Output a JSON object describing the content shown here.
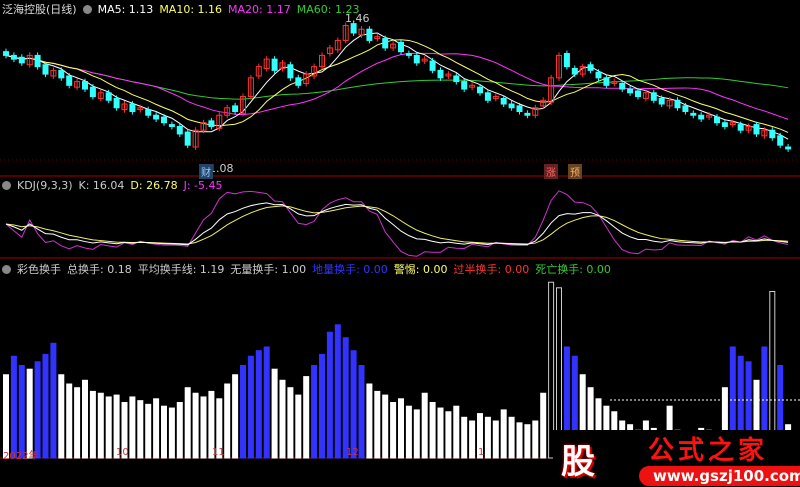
{
  "header": {
    "title": "泛海控股(日线)",
    "ma5": "MA5: 1.13",
    "ma10": "MA10: 1.16",
    "ma20": "MA20: 1.17",
    "ma60": "MA60: 1.23",
    "high_label": "1.46",
    "low_label": "1.08",
    "tag_cai": "财",
    "tag_zhang": "涨",
    "tag_yu": "预"
  },
  "kdj": {
    "name": "KDJ(9,3,3)",
    "k": "K: 16.04",
    "d": "D: 26.78",
    "j": "J: -5.45"
  },
  "turnover": {
    "name": "彩色换手",
    "total": "总换手: 0.18",
    "avg": "平均换手线: 1.19",
    "none": "无量换手: 1.00",
    "low": "地量换手: 0.00",
    "warn": "警惕: 0.00",
    "half": "过半换手: 0.00",
    "dead": "死亡换手: 0.00"
  },
  "axis": {
    "labels": [
      "2022年",
      "10",
      "11",
      "12",
      "1"
    ]
  },
  "logo": {
    "char": "股",
    "name": "公式之家",
    "url": "www.gszj100.com"
  },
  "colors": {
    "up": "#ff3333",
    "down": "#33ffff",
    "ma5": "#ffffff",
    "ma10": "#ffff66",
    "ma20": "#ff33ff",
    "ma60": "#33cc33",
    "blue": "#3333ff"
  },
  "chart_data": {
    "type": "candlestick",
    "closes": [
      1.36,
      1.35,
      1.34,
      1.36,
      1.33,
      1.31,
      1.32,
      1.3,
      1.28,
      1.29,
      1.27,
      1.25,
      1.26,
      1.24,
      1.22,
      1.23,
      1.21,
      1.22,
      1.2,
      1.19,
      1.18,
      1.17,
      1.15,
      1.12,
      1.16,
      1.18,
      1.17,
      1.2,
      1.22,
      1.21,
      1.25,
      1.3,
      1.33,
      1.35,
      1.32,
      1.34,
      1.3,
      1.28,
      1.31,
      1.33,
      1.36,
      1.38,
      1.4,
      1.44,
      1.42,
      1.43,
      1.4,
      1.41,
      1.38,
      1.39,
      1.37,
      1.36,
      1.34,
      1.35,
      1.32,
      1.3,
      1.31,
      1.29,
      1.27,
      1.28,
      1.26,
      1.24,
      1.25,
      1.23,
      1.22,
      1.21,
      1.2,
      1.22,
      1.24,
      1.3,
      1.36,
      1.33,
      1.31,
      1.33,
      1.32,
      1.3,
      1.28,
      1.29,
      1.27,
      1.26,
      1.25,
      1.26,
      1.24,
      1.23,
      1.24,
      1.22,
      1.21,
      1.2,
      1.19,
      1.2,
      1.18,
      1.17,
      1.18,
      1.16,
      1.17,
      1.15,
      1.16,
      1.14,
      1.12,
      1.11
    ],
    "turnover": [
      0.45,
      0.55,
      0.5,
      0.48,
      0.52,
      0.56,
      0.62,
      0.45,
      0.4,
      0.38,
      0.42,
      0.36,
      0.35,
      0.33,
      0.34,
      0.3,
      0.33,
      0.31,
      0.29,
      0.32,
      0.28,
      0.27,
      0.3,
      0.38,
      0.35,
      0.33,
      0.36,
      0.32,
      0.4,
      0.45,
      0.5,
      0.55,
      0.58,
      0.6,
      0.48,
      0.42,
      0.38,
      0.34,
      0.44,
      0.5,
      0.56,
      0.68,
      0.72,
      0.65,
      0.58,
      0.5,
      0.4,
      0.36,
      0.34,
      0.3,
      0.32,
      0.28,
      0.26,
      0.35,
      0.3,
      0.27,
      0.25,
      0.28,
      0.22,
      0.2,
      0.24,
      0.22,
      0.2,
      0.26,
      0.22,
      0.19,
      0.18,
      0.2,
      0.35,
      0.95,
      0.92,
      0.6,
      0.55,
      0.45,
      0.38,
      0.32,
      0.28,
      0.25,
      0.2,
      0.18,
      0.15,
      0.2,
      0.16,
      0.14,
      0.28,
      0.15,
      0.14,
      0.13,
      0.16,
      0.15,
      0.14,
      0.38,
      0.6,
      0.55,
      0.52,
      0.42,
      0.6,
      0.9,
      0.5,
      0.18
    ]
  }
}
